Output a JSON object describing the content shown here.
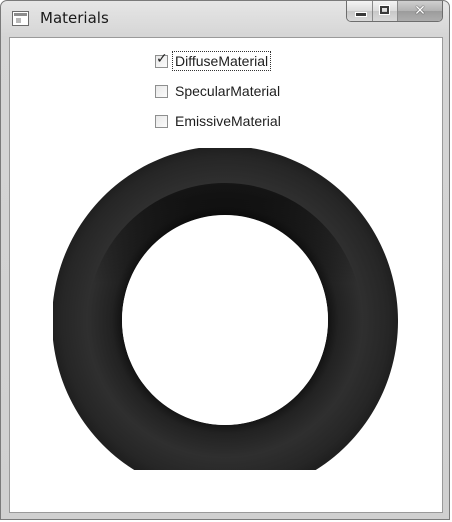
{
  "window": {
    "title": "Materials",
    "icon": "window-app-icon",
    "controls": {
      "minimize": "minimize-icon",
      "maximize": "maximize-icon",
      "close": "close-icon",
      "close_glyph": "✕"
    }
  },
  "options": [
    {
      "label": "DiffuseMaterial",
      "checked": true,
      "focused": true
    },
    {
      "label": "SpecularMaterial",
      "checked": false,
      "focused": false
    },
    {
      "label": "EmissiveMaterial",
      "checked": false,
      "focused": false
    }
  ],
  "checkmark": "✓",
  "scene": {
    "object": "torus",
    "color": "#2b2b2b",
    "shadow_color": "#111111"
  }
}
